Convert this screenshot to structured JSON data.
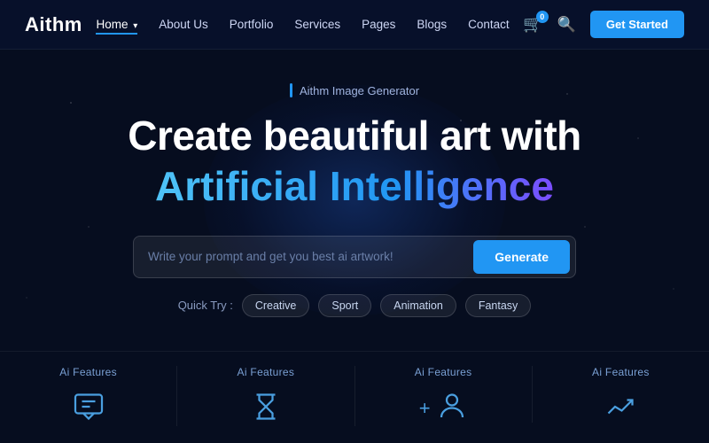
{
  "brand": {
    "logo": "Aithm"
  },
  "navbar": {
    "links": [
      {
        "label": "Home",
        "active": true,
        "has_arrow": true
      },
      {
        "label": "About Us",
        "active": false,
        "has_arrow": false
      },
      {
        "label": "Portfolio",
        "active": false,
        "has_arrow": false
      },
      {
        "label": "Services",
        "active": false,
        "has_arrow": false
      },
      {
        "label": "Pages",
        "active": false,
        "has_arrow": false
      },
      {
        "label": "Blogs",
        "active": false,
        "has_arrow": false
      },
      {
        "label": "Contact",
        "active": false,
        "has_arrow": false
      }
    ],
    "cart_count": "0",
    "get_started": "Get Started"
  },
  "hero": {
    "tag": "Aithm Image Generator",
    "title_line1": "Create beautiful art with",
    "title_line2": "Artificial Intelligence",
    "search_placeholder": "Write your prompt and get you best ai artwork!",
    "generate_btn": "Generate",
    "quick_try_label": "Quick Try :",
    "quick_tags": [
      "Creative",
      "Sport",
      "Animation",
      "Fantasy"
    ]
  },
  "features": [
    {
      "label": "Ai Features",
      "icon": "chat-icon"
    },
    {
      "label": "Ai Features",
      "icon": "hourglass-icon"
    },
    {
      "label": "Ai Features",
      "icon": "person-icon",
      "plus": true
    },
    {
      "label": "Ai Features",
      "icon": "chart-icon"
    }
  ]
}
